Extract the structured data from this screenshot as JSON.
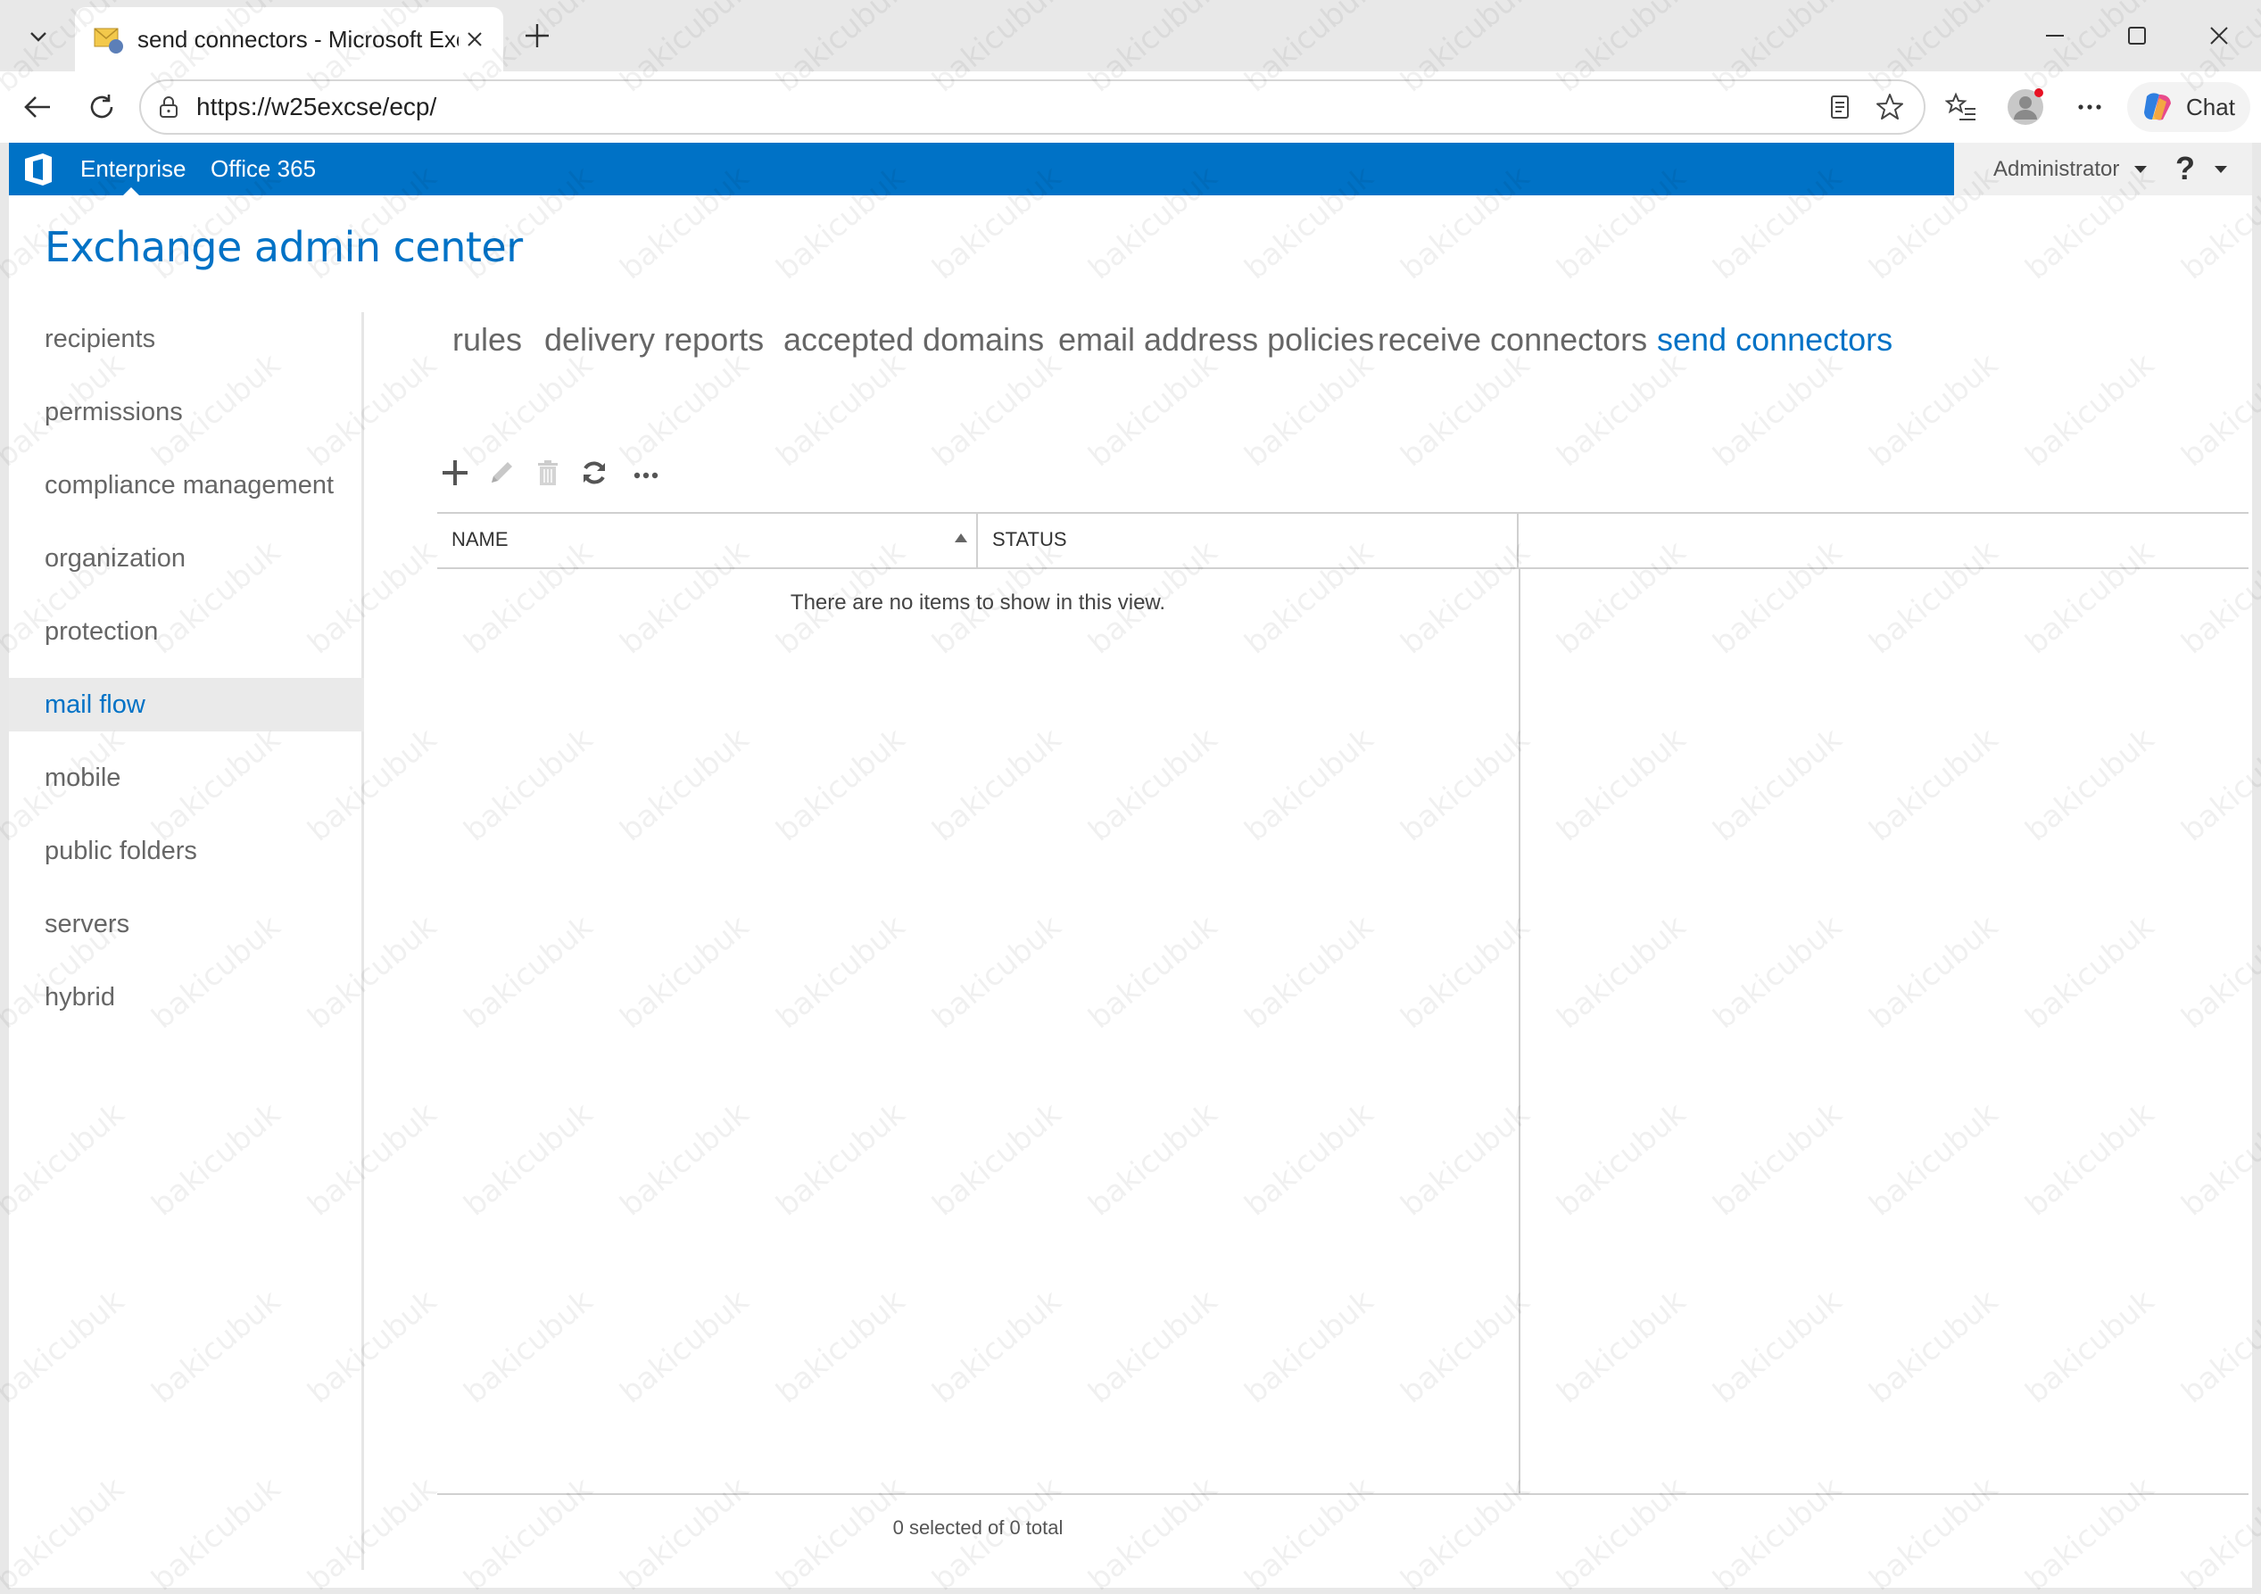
{
  "browser": {
    "tab_title": "send connectors - Microsoft Excha",
    "url": "https://w25excse/ecp/",
    "chat_label": "Chat"
  },
  "o365": {
    "enterprise": "Enterprise",
    "office365": "Office 365",
    "user": "Administrator",
    "help": "?"
  },
  "app_title": "Exchange admin center",
  "nav": {
    "items": [
      {
        "label": "recipients"
      },
      {
        "label": "permissions"
      },
      {
        "label": "compliance management"
      },
      {
        "label": "organization"
      },
      {
        "label": "protection"
      },
      {
        "label": "mail flow"
      },
      {
        "label": "mobile"
      },
      {
        "label": "public folders"
      },
      {
        "label": "servers"
      },
      {
        "label": "hybrid"
      }
    ],
    "selected": "mail flow"
  },
  "subtabs": [
    {
      "label": "rules"
    },
    {
      "label": "delivery reports"
    },
    {
      "label": "accepted domains"
    },
    {
      "label": "email address policies"
    },
    {
      "label": "receive connectors"
    },
    {
      "label": "send connectors"
    }
  ],
  "active_subtab": "send connectors",
  "grid": {
    "columns": [
      "NAME",
      "STATUS"
    ],
    "empty_message": "There are no items to show in this view.",
    "count_text": "0 selected of 0 total"
  },
  "watermark": "bakicubuk",
  "colors": {
    "accent": "#0072c6"
  }
}
